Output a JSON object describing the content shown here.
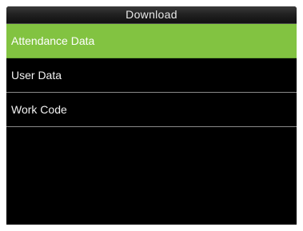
{
  "header": {
    "title": "Download"
  },
  "menu": {
    "items": [
      {
        "label": "Attendance Data",
        "selected": true
      },
      {
        "label": "User Data",
        "selected": false
      },
      {
        "label": "Work Code",
        "selected": false
      }
    ]
  },
  "colors": {
    "selected_background": "#82c341",
    "screen_background": "#000000",
    "divider": "#8a8a8a",
    "text": "#f2f2f2"
  }
}
